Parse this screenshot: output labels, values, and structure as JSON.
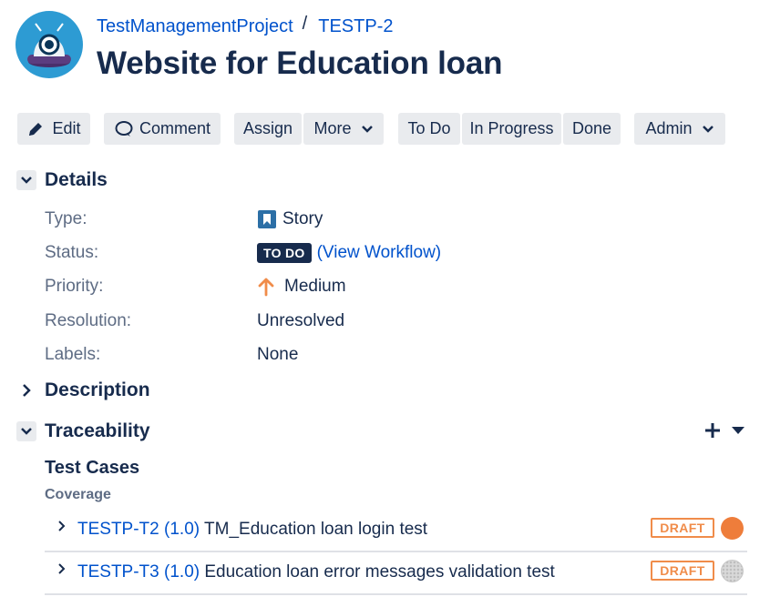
{
  "header": {
    "project": "TestManagementProject",
    "separator": "/",
    "issue_key": "TESTP-2",
    "title": "Website for Education loan"
  },
  "toolbar": {
    "edit": "Edit",
    "comment": "Comment",
    "assign": "Assign",
    "more": "More",
    "todo": "To Do",
    "in_progress": "In Progress",
    "done": "Done",
    "admin": "Admin"
  },
  "details": {
    "heading": "Details",
    "fields": [
      {
        "label": "Type:",
        "value": "Story"
      },
      {
        "label": "Status:",
        "value": "TO DO",
        "link_open": "(",
        "link_text": "View Workflow",
        "link_close": ")"
      },
      {
        "label": "Priority:",
        "value": "Medium"
      },
      {
        "label": "Resolution:",
        "value": "Unresolved"
      },
      {
        "label": "Labels:",
        "value": "None"
      }
    ]
  },
  "description": {
    "heading": "Description"
  },
  "traceability": {
    "heading": "Traceability",
    "add_icon": "plus-icon",
    "dropdown_icon": "caret-down-icon",
    "test_cases_title": "Test Cases",
    "coverage_label": "Coverage",
    "rows": [
      {
        "key": "TESTP-T2",
        "version": "(1.0)",
        "name": "TM_Education loan login test",
        "status": "DRAFT",
        "result_color": "#ee7d3b",
        "result": "filled"
      },
      {
        "key": "TESTP-T3",
        "version": "(1.0)",
        "name": "Education loan error messages validation test",
        "status": "DRAFT",
        "result_color": "#c8c8c8",
        "result": "none"
      }
    ]
  },
  "colors": {
    "link": "#0052cc",
    "text": "#172b4d",
    "muted": "#5e6c84",
    "button_bg": "#e9ebee",
    "draft": "#f08c4a",
    "priority_medium": "#f08c4a",
    "story": "#2c6fa6",
    "avatar": "#2d9bd3"
  }
}
